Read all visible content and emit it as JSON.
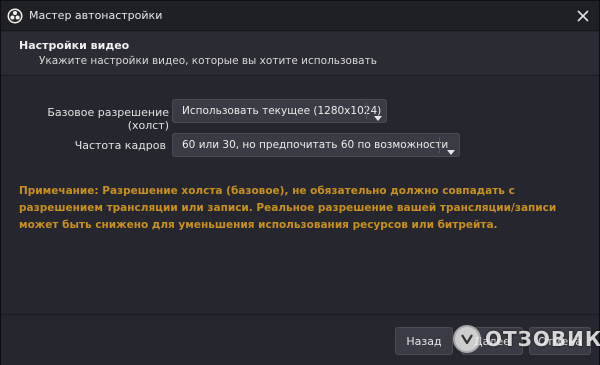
{
  "window": {
    "title": "Мастер автонастройки",
    "close_icon": "close-icon"
  },
  "header": {
    "title": "Настройки видео",
    "subtitle": "Укажите настройки видео, которые вы хотите использовать"
  },
  "form": {
    "base_resolution": {
      "label": "Базовое разрешение (холст)",
      "value": "Использовать текущее (1280x1024)"
    },
    "fps": {
      "label": "Частота кадров",
      "value": "60 или 30, но предпочитать 60 по возможности"
    }
  },
  "note": "Примечание: Разрешение холста (базовое), не обязательно должно совпадать с разрешением трансляции или записи. Реальное разрешение вашей трансляции/записи может быть снижено для уменьшения использования ресурсов или битрейта.",
  "footer": {
    "back_label": "Назад",
    "next_label": "Далее",
    "cancel_label": "Отмена"
  },
  "watermark": {
    "text": "ОТЗОВИК"
  },
  "colors": {
    "note": "#c89020",
    "background": "#26272e",
    "titlebar": "#1f2026"
  }
}
